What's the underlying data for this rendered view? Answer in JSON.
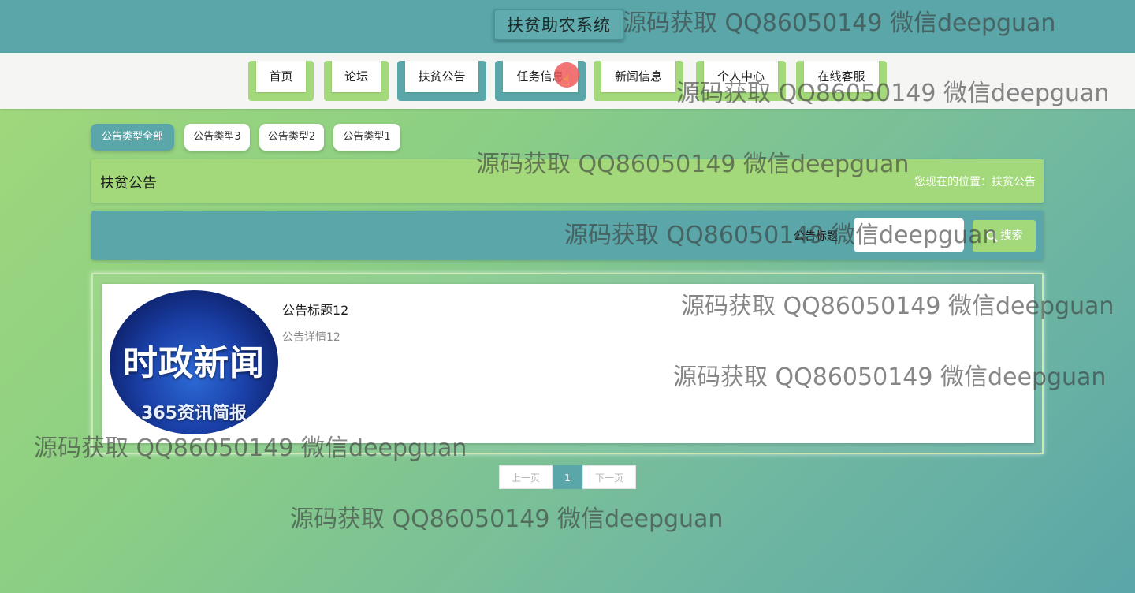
{
  "header": {
    "site_title": "扶贫助农系统"
  },
  "nav": {
    "items": [
      {
        "label": "首页"
      },
      {
        "label": "论坛"
      },
      {
        "label": "扶贫公告"
      },
      {
        "label": "任务信息"
      },
      {
        "label": "新闻信息"
      },
      {
        "label": "个人中心"
      },
      {
        "label": "在线客服"
      }
    ]
  },
  "type_tabs": [
    {
      "label": "公告类型全部",
      "active": true
    },
    {
      "label": "公告类型3"
    },
    {
      "label": "公告类型2"
    },
    {
      "label": "公告类型1"
    }
  ],
  "section": {
    "title": "扶贫公告",
    "breadcrumb": "您现在的位置：扶贫公告"
  },
  "search": {
    "label": "公告标题",
    "value": "",
    "button_label": "搜索"
  },
  "list": {
    "items": [
      {
        "title": "公告标题12",
        "desc": "公告详情12",
        "image_text_main": "时政新闻",
        "image_text_sub": "365资讯简报"
      }
    ]
  },
  "pagination": {
    "prev_label": "上一页",
    "current_page": "1",
    "next_label": "下一页"
  },
  "watermark": {
    "text": "源码获取 QQ86050149 微信deepguan"
  },
  "colors": {
    "teal": "#5aa6a8",
    "green": "#a3d97a",
    "nav_bg": "#f5f6f4",
    "white": "#ffffff"
  },
  "icons": {
    "search_button": "search-icon",
    "cursor": "pointer-hand-icon"
  }
}
